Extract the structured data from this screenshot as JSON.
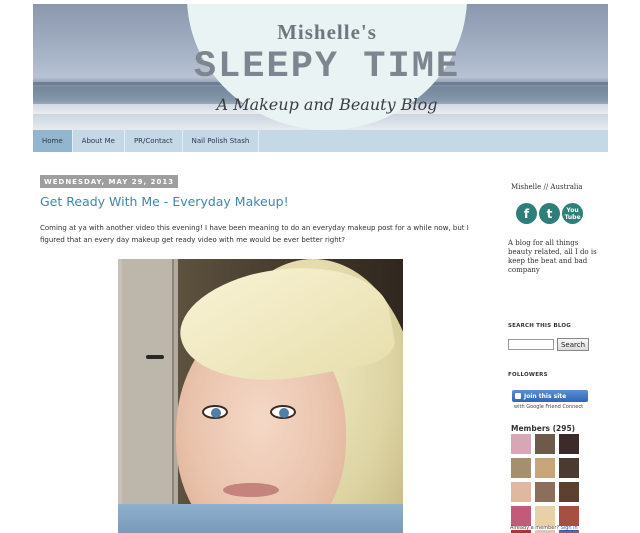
{
  "header": {
    "line1": "Mishelle's",
    "line2": "SLEEPY TIME",
    "line3": "A Makeup and Beauty Blog"
  },
  "nav": {
    "tabs": [
      {
        "label": "Home",
        "active": true
      },
      {
        "label": "About Me",
        "active": false
      },
      {
        "label": "PR/Contact",
        "active": false
      },
      {
        "label": "Nail Polish Stash",
        "active": false
      }
    ]
  },
  "post": {
    "date": "WEDNESDAY, MAY 29, 2013",
    "title": "Get Ready With Me - Everyday Makeup!",
    "body": "Coming at ya with another video this evening! I have been meaning to do an everyday makeup post for a while now, but I figured that an every day makeup get ready video with me would be ever better right?"
  },
  "sidebar": {
    "name": "Mishelle // Australia",
    "social": {
      "facebook": "f",
      "twitter": "t",
      "youtube": "You Tube"
    },
    "description": "A blog for all things beauty related, all I do is keep the beat and bad company",
    "search_heading": "SEARCH THIS BLOG",
    "search_button": "Search",
    "followers_heading": "FOLLOWERS",
    "join_label": "Join this site",
    "join_sub": "with Google Friend Connect",
    "members_label": "Members (295)",
    "already_text": "Already a member?",
    "sign_in": "Sign in"
  },
  "colors": {
    "accent_title": "#4187a8",
    "nav_bg": "#c4d8e6",
    "nav_active": "#92b6cd",
    "social_icons": "#2e7f79"
  },
  "member_avatars": [
    "#d8a7b5",
    "#6e5a4a",
    "#3b2b2a",
    "#a48f6f",
    "#c9a57a",
    "#4b3a2f",
    "#e0b8a0",
    "#8c6f5a",
    "#5c4030",
    "#c25a7a",
    "#e7d2a8",
    "#a55040",
    "#b7322f",
    "#dcc7b3",
    "#7a6858"
  ]
}
